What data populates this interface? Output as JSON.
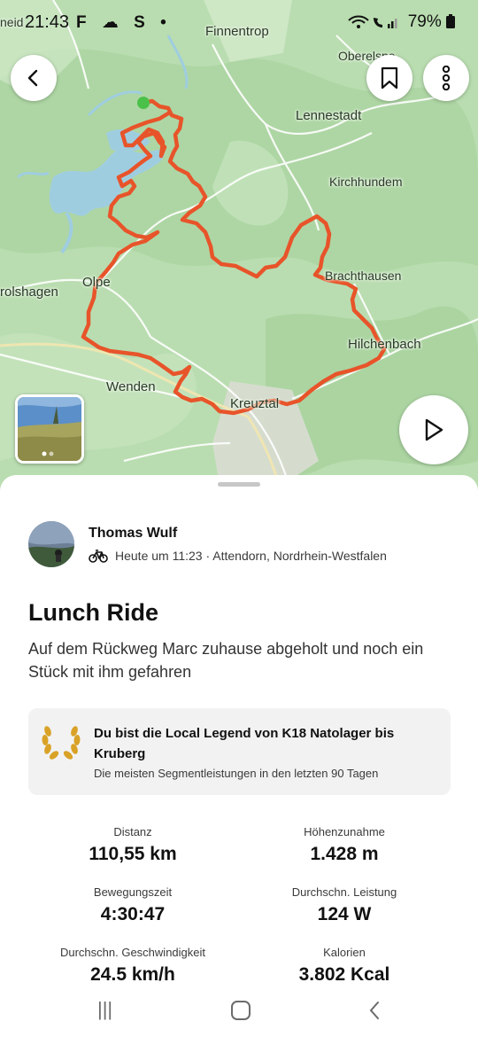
{
  "status_bar": {
    "time": "21:43",
    "left_icons": "F ☁ S •",
    "right_icons": "wifi call signal",
    "battery": "79%"
  },
  "map": {
    "towns": {
      "finnentrop": "Finnentrop",
      "oberelspe": "Oberelspe",
      "lennestadt": "Lennestadt",
      "kirchhundem": "Kirchhundem",
      "olpe": "Olpe",
      "olshagen": "rolshagen",
      "brachthausen": "Brachthausen",
      "hilchenbach": "Hilchenbach",
      "wenden": "Wenden",
      "kreuztal": "Kreuztal",
      "top_left": "neid"
    },
    "route_color": "#e8542a",
    "start_color": "#4cc14a",
    "icons": {
      "back": "arrow-left-icon",
      "bookmark": "bookmark-icon",
      "more": "more-vertical-icon",
      "play": "play-icon"
    }
  },
  "activity": {
    "athlete_name": "Thomas Wulf",
    "activity_icon": "bike-icon",
    "meta": "Heute um 11:23 · Attendorn, Nordrhein-Westfalen",
    "title": "Lunch Ride",
    "description": "Auf dem Rückweg Marc zuhause abgeholt und noch ein Stück mit ihm gefahren"
  },
  "local_legend": {
    "icon": "laurel-wreath-icon",
    "title": "Du bist die Local Legend von K18 Natolager bis Kruberg",
    "subtitle": "Die meisten Segmentleistungen in den letzten 90 Tagen",
    "accent": "#d9a227"
  },
  "stats": {
    "distance_label": "Distanz",
    "distance_value": "110,55 km",
    "elevation_label": "Höhenzunahme",
    "elevation_value": "1.428 m",
    "moving_time_label": "Bewegungszeit",
    "moving_time_value": "4:30:47",
    "power_label": "Durchschn. Leistung",
    "power_value": "124 W",
    "speed_label": "Durchschn. Geschwindigkeit",
    "speed_value": "24.5 km/h",
    "calories_label": "Kalorien",
    "calories_value": "3.802 Kcal"
  },
  "nav_bar": {
    "recents": "|||",
    "home": "home-icon",
    "back": "back-icon"
  }
}
